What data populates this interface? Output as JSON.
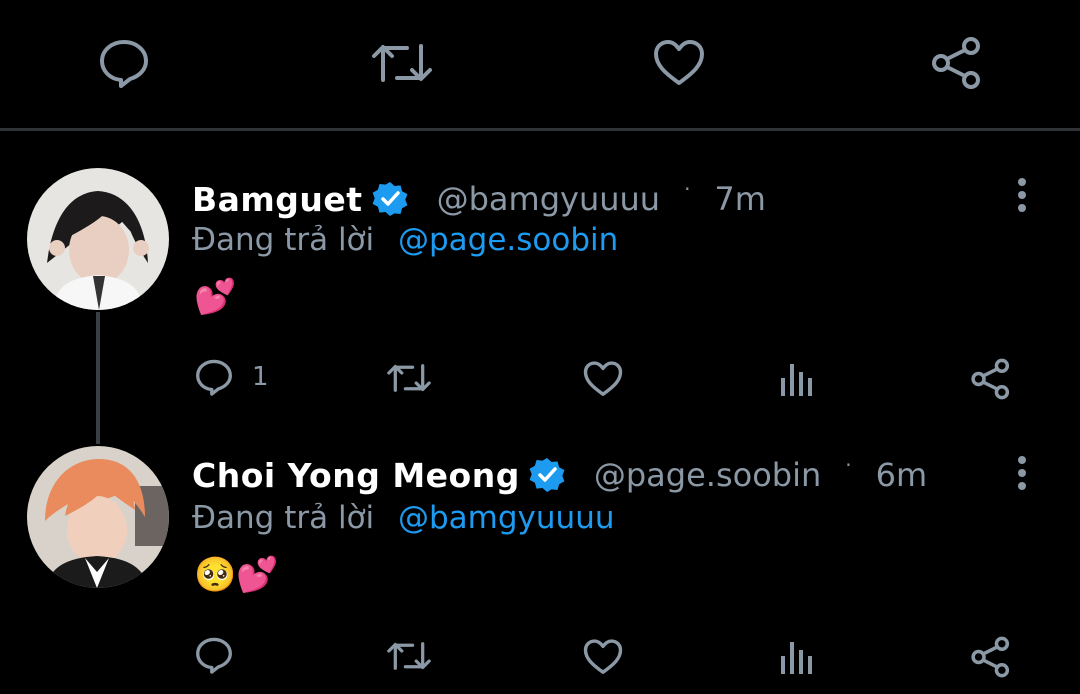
{
  "top_actions": [
    "reply-icon",
    "retweet-icon",
    "like-icon",
    "share-icon"
  ],
  "colors": {
    "accent": "#1d9bf0",
    "muted": "#8b98a5",
    "background": "#000000",
    "divider": "#2f3336"
  },
  "tweets": [
    {
      "name": "Bamguet",
      "verified": true,
      "handle": "@bamgyuuuu",
      "separator": "·",
      "time": "7m",
      "replying_prefix": "Đang trả lời",
      "replying_to": "@page.soobin",
      "content": "💕",
      "reply_count": "1"
    },
    {
      "name": "Choi Yong Meong",
      "verified": true,
      "handle": "@page.soobin",
      "separator": "·",
      "time": "6m",
      "replying_prefix": "Đang trả lời",
      "replying_to": "@bamgyuuuu",
      "content": "🥺💕",
      "reply_count": ""
    }
  ]
}
